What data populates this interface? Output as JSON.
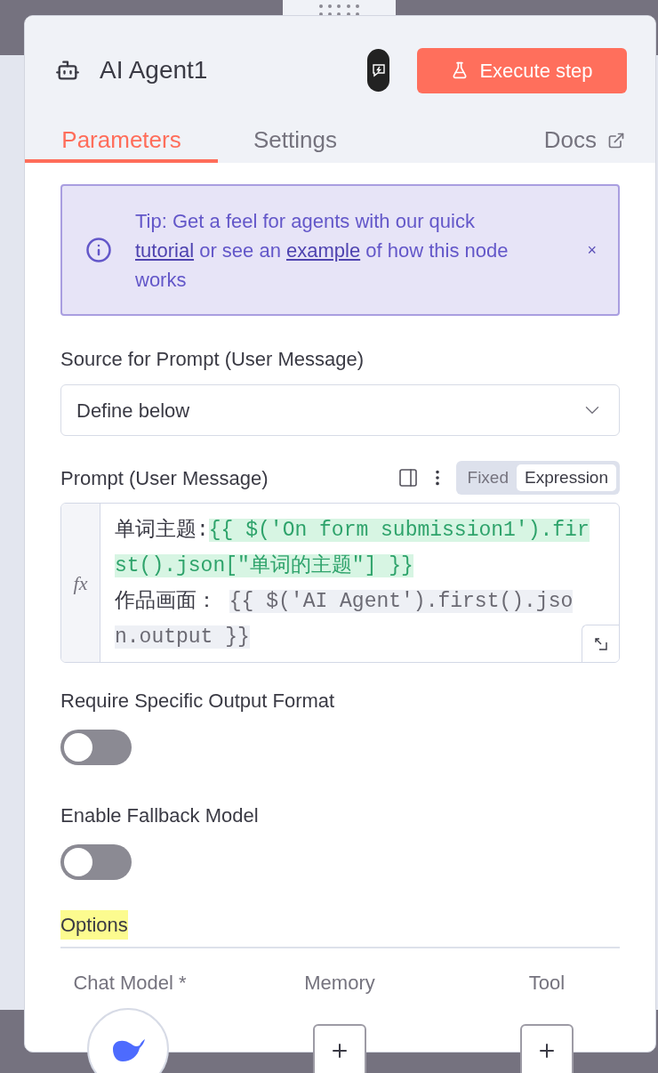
{
  "node": {
    "title": "AI Agent1",
    "execute_button": "Execute step"
  },
  "tabs": [
    {
      "label": "Parameters",
      "selected": true
    },
    {
      "label": "Settings",
      "selected": false
    }
  ],
  "docs_link": "Docs",
  "tip": {
    "parts": [
      {
        "kind": "text",
        "text": "Tip: Get a feel for agents with our quick "
      },
      {
        "kind": "link",
        "text": "tutorial"
      },
      {
        "kind": "text",
        "text": " or see an "
      },
      {
        "kind": "link",
        "text": "example"
      },
      {
        "kind": "text",
        "text": " of how this node works"
      }
    ],
    "close": "×"
  },
  "source_field": {
    "label": "Source for Prompt (User Message)",
    "value": "Define below"
  },
  "prompt": {
    "label": "Prompt (User Message)",
    "mode_options": [
      {
        "label": "Fixed",
        "selected": false
      },
      {
        "label": "Expression",
        "selected": true
      }
    ],
    "gutter": "fx",
    "lines": [
      [
        {
          "kind": "text",
          "text": "单词主题:"
        },
        {
          "kind": "resolved",
          "text": "{{ $('On form submission1').first().json[\"单词的主题\"] }}"
        }
      ],
      [
        {
          "kind": "text",
          "text": "作品画面： "
        },
        {
          "kind": "unresolved",
          "text": "{{ $('AI Agent').first().json.output }}"
        }
      ]
    ]
  },
  "toggles": [
    {
      "label": "Require Specific Output Format",
      "on": false
    },
    {
      "label": "Enable Fallback Model",
      "on": false
    }
  ],
  "options_heading": "Options",
  "sub_nodes": [
    {
      "label": "Chat Model *",
      "kind": "model"
    },
    {
      "label": "Memory",
      "kind": "add"
    },
    {
      "label": "Tool",
      "kind": "add"
    }
  ]
}
